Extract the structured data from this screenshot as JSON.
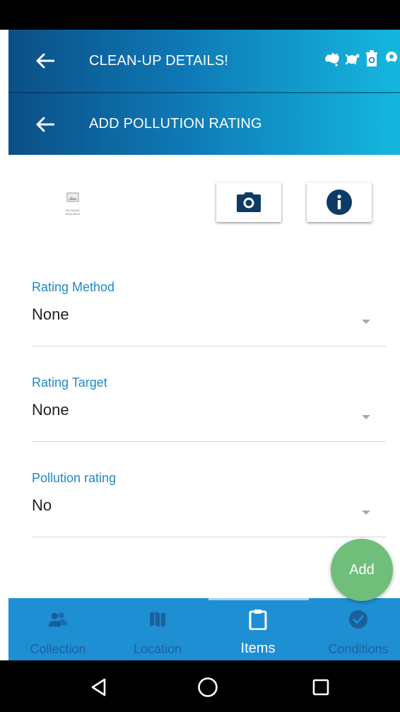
{
  "header": {
    "title": "CLEAN-UP DETAILS!",
    "subtitle": "ADD POLLUTION RATING",
    "brand_icons": [
      "australia-map-icon",
      "turtle-icon",
      "recycle-bin-icon",
      "person-icon"
    ]
  },
  "media": {
    "no_image_text": "NO IMAGE AVAILABLE",
    "camera_icon": "camera-icon",
    "info_icon": "info-icon"
  },
  "form": {
    "fields": [
      {
        "label": "Rating Method",
        "value": "None"
      },
      {
        "label": "Rating Target",
        "value": "None"
      },
      {
        "label": "Pollution rating",
        "value": "No"
      }
    ]
  },
  "fab": {
    "label": "Add",
    "color": "#6fbf7a"
  },
  "bottom_nav": {
    "items": [
      {
        "label": "Collection",
        "icon": "people-icon",
        "active": false
      },
      {
        "label": "Location",
        "icon": "map-icon",
        "active": false
      },
      {
        "label": "Items",
        "icon": "clipboard-icon",
        "active": true
      },
      {
        "label": "Conditions",
        "icon": "check-circle-icon",
        "active": false
      }
    ]
  },
  "colors": {
    "header_start": "#0b4f86",
    "header_end": "#15b7df",
    "accent": "#1e88c9",
    "nav_bg": "#1f8fd4",
    "icon_dark": "#0d3b66"
  }
}
